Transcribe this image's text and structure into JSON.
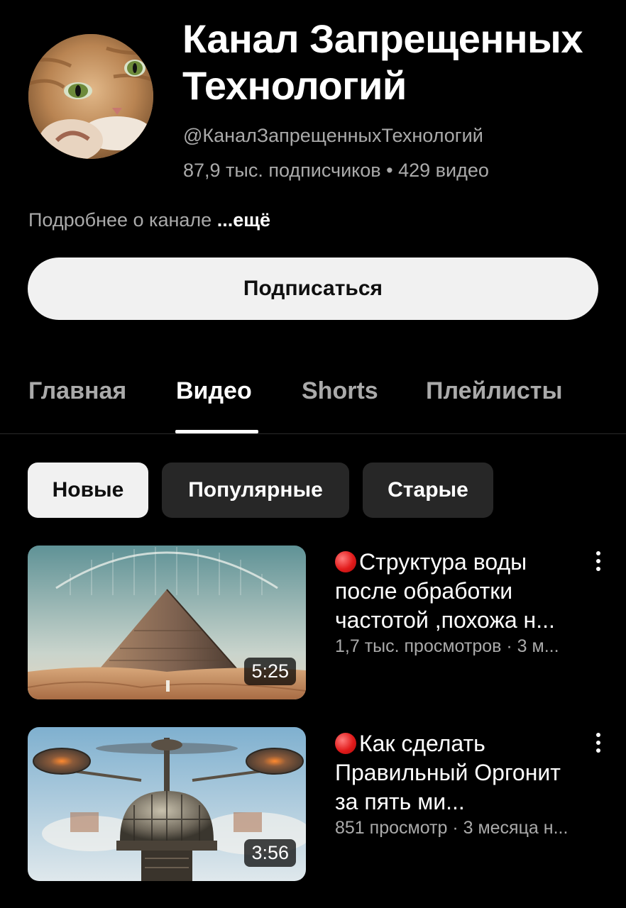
{
  "channel": {
    "title": "Канал Запрещенных Технологий",
    "handle": "@КаналЗапрещенныхТехнологий",
    "stats": "87,9 тыс. подписчиков • 429 видео",
    "description": "Подробнее о канале",
    "more_label": "...ещё",
    "subscribe_label": "Подписаться"
  },
  "tabs": [
    {
      "label": "Главная",
      "active": false
    },
    {
      "label": "Видео",
      "active": true
    },
    {
      "label": "Shorts",
      "active": false
    },
    {
      "label": "Плейлисты",
      "active": false
    }
  ],
  "sort_chips": [
    {
      "label": "Новые",
      "selected": true
    },
    {
      "label": "Популярные",
      "selected": false
    },
    {
      "label": "Старые",
      "selected": false
    }
  ],
  "videos": [
    {
      "title": "Структура воды после обработки частотой ,похожа н...",
      "meta": "1,7 тыс. просмотров · 3 м...",
      "duration": "5:25",
      "thumbnail": "pyramid-in-desert-with-dome"
    },
    {
      "title": "Как сделать Правильный Оргонит за пять ми...",
      "meta": "851 просмотр · 3 месяца н...",
      "duration": "3:56",
      "thumbnail": "steampunk-flying-machine"
    }
  ],
  "colors": {
    "background": "#000000",
    "secondary_text": "#aaaaaa",
    "chip_bg": "#272727",
    "selected_chip_bg": "#f1f1f1",
    "live_dot": "#e21b1b"
  }
}
